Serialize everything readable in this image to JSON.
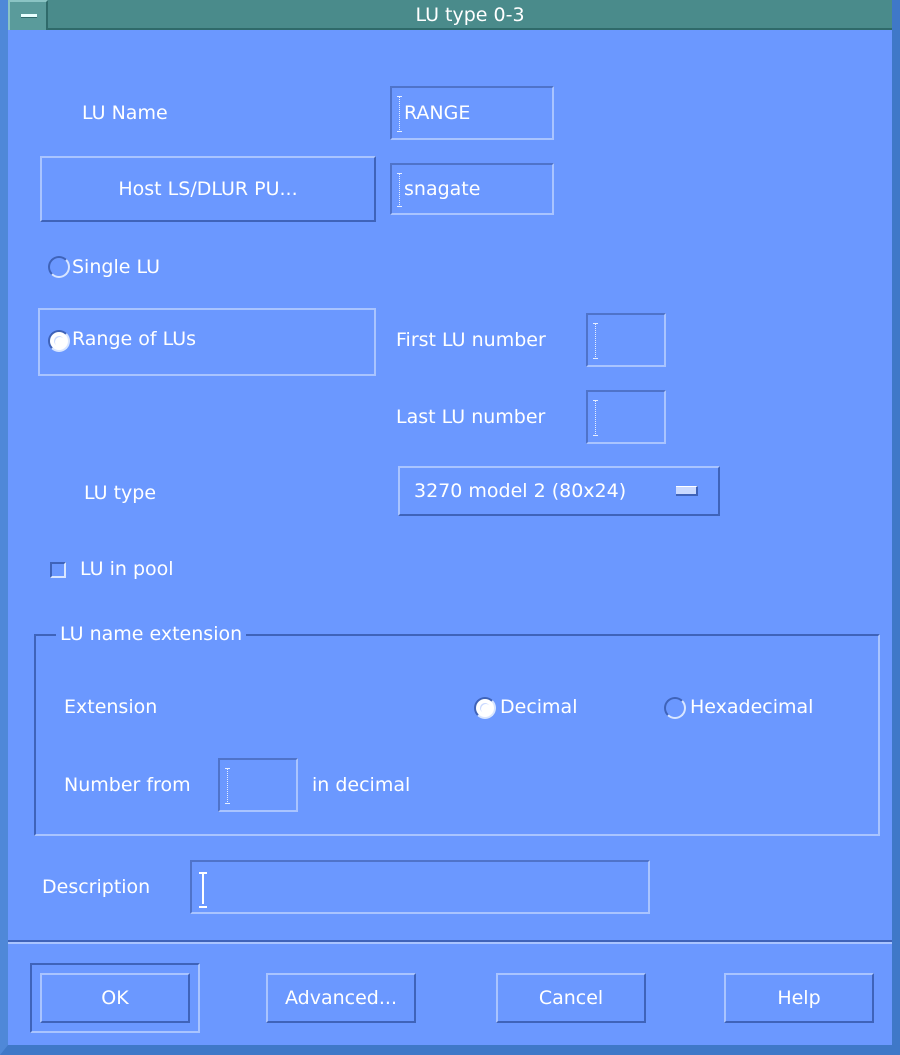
{
  "window": {
    "title": "LU type 0-3"
  },
  "lu_name": {
    "label": "LU Name",
    "value": "RANGE"
  },
  "host": {
    "button_label": "Host LS/DLUR PU...",
    "value": "snagate"
  },
  "mode": {
    "single_label": "Single LU",
    "range_label": "Range of LUs",
    "selected": "Range of LUs"
  },
  "range": {
    "first_label": "First LU number",
    "first_value": "",
    "last_label": "Last LU number",
    "last_value": ""
  },
  "lu_type": {
    "label": "LU type",
    "selected": "3270 model 2 (80x24)"
  },
  "pool": {
    "label": "LU in pool",
    "checked": false
  },
  "extension_group": {
    "title": "LU name extension",
    "extension_label": "Extension",
    "decimal_label": "Decimal",
    "hex_label": "Hexadecimal",
    "selected": "Decimal",
    "number_from_label": "Number from",
    "number_from_value": "",
    "suffix": "in decimal"
  },
  "description": {
    "label": "Description",
    "value": ""
  },
  "buttons": {
    "ok": "OK",
    "advanced": "Advanced...",
    "cancel": "Cancel",
    "help": "Help"
  }
}
